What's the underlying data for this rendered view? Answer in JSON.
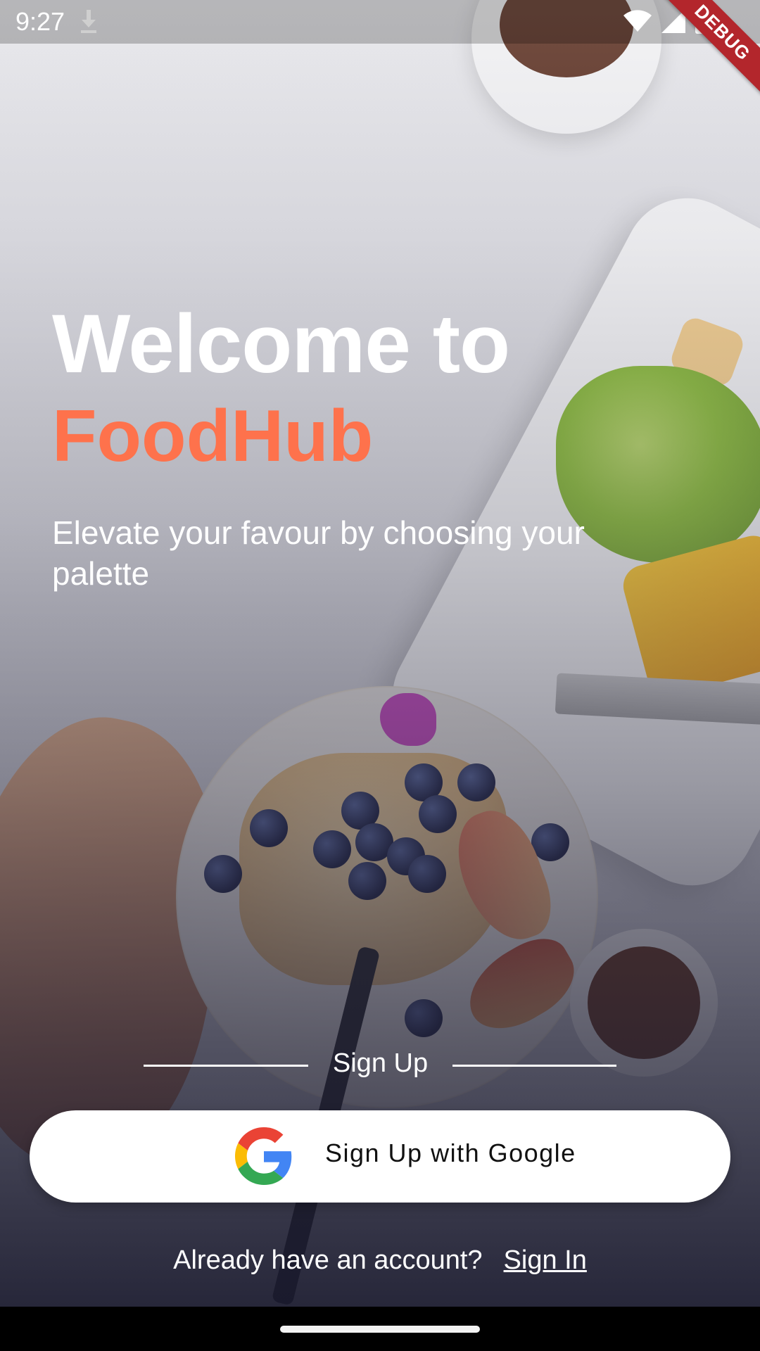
{
  "status_bar": {
    "time": "9:27",
    "icons": [
      "download-icon",
      "wifi-icon",
      "cell-signal-icon",
      "battery-icon"
    ]
  },
  "debug_banner": "DEBUG",
  "hero": {
    "title_line1": "Welcome to",
    "title_line2": "FoodHub",
    "subtitle": "Elevate your favour by choosing your palette"
  },
  "signup": {
    "divider_label": "Sign Up",
    "google_button_label": "Sign Up with Google"
  },
  "footer": {
    "prompt": "Already have an account?",
    "sign_in_link": "Sign In"
  },
  "colors": {
    "accent": "#FE724C",
    "text_light": "#FFFFFF",
    "button_bg": "#FFFFFF",
    "debug_banner": "#B3262C"
  }
}
